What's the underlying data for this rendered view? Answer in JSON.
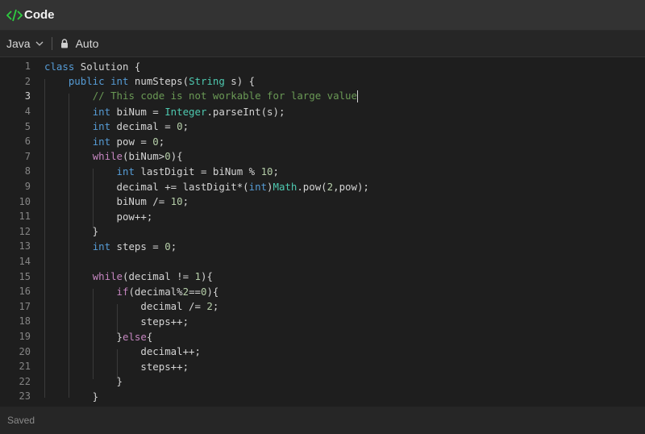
{
  "window": {
    "title": "Code",
    "icon": "code-icon",
    "accent_color": "#2ecc40"
  },
  "toolbar": {
    "language": "Java",
    "mode": "Auto"
  },
  "editor": {
    "active_line": 3,
    "lines": [
      "class Solution {",
      "    public int numSteps(String s) {",
      "        // This code is not workable for large value",
      "        int biNum = Integer.parseInt(s);",
      "        int decimal = 0;",
      "        int pow = 0;",
      "        while(biNum>0){",
      "            int lastDigit = biNum % 10;",
      "            decimal += lastDigit*(int)Math.pow(2,pow);",
      "            biNum /= 10;",
      "            pow++;",
      "        }",
      "        int steps = 0;",
      "",
      "        while(decimal != 1){",
      "            if(decimal%2==0){",
      "                decimal /= 2;",
      "                steps++;",
      "            }else{",
      "                decimal++;",
      "                steps++;",
      "            }",
      "        }"
    ]
  },
  "status": {
    "text": "Saved"
  }
}
